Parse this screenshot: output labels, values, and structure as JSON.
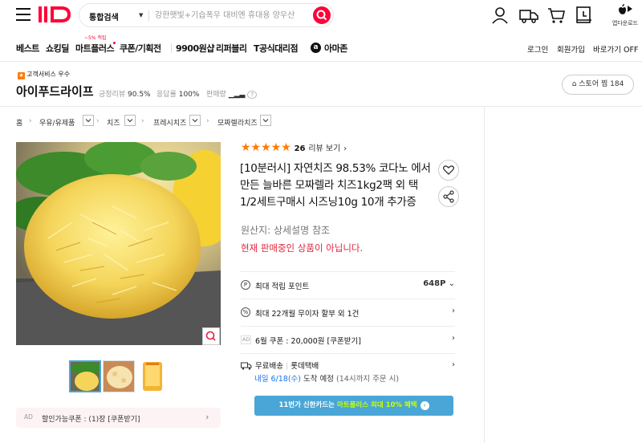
{
  "header": {
    "logo": "11",
    "search_category": "통합검색",
    "search_placeholder": "강한햇빛+기습폭우 대비엔 휴대용 양우산",
    "app_label": "앱다운로드"
  },
  "nav": {
    "items": [
      "베스트",
      "쇼킹딜",
      "마트플러스",
      "쿠폰/기획전",
      "9900원샵",
      "리퍼블리",
      "T공식대리점",
      "아마존"
    ],
    "badge": "~5% 적립",
    "right": [
      "로그인",
      "회원가입",
      "바로가기 OFF"
    ]
  },
  "store": {
    "badge": "고객서비스 우수",
    "name": "아이푸드라이프",
    "review_label": "긍정리뷰",
    "review_value": "90.5%",
    "reply_label": "응답률",
    "reply_value": "100%",
    "sales_label": "판매량",
    "store_button": "스토어 찜 184"
  },
  "breadcrumb": [
    "홈",
    "우유/유제품",
    "치즈",
    "프레시치즈",
    "모짜렐라치즈"
  ],
  "product": {
    "rating_stars": "★★★★★",
    "review_count": "26",
    "review_link": "리뷰 보기",
    "title": "[10분러시] 자연치즈 98.53% 코다노 에서만든 늘바른 모짜렐라 치즈1kg2팩 외 택1/2세트구매시 시즈닝10g 10개 추가증",
    "origin": "원산지: 상세설명 참조",
    "not_on_sale": "현재 판매중인 상품이 아닙니다.",
    "rows": {
      "points_label": "최대 적립 포인트",
      "points_value": "648P",
      "installment": "최대 22개월 무이자 할부 외 1건",
      "ad_tag": "AD",
      "coupon": "6월 쿠폰 : 20,000원 [쿠폰받기]",
      "shipping": "무료배송",
      "carrier": "롯데택배",
      "delivery_date": "내일 6/18(수)",
      "delivery_rest": "도착 예정",
      "delivery_note": "(14시까지 주문 시)"
    },
    "cta_prefix": "11번가 신한카드는",
    "cta_highlight": "마트플러스 최대 10% 혜택",
    "discount_coupon": "할인가능쿠폰 : (1)장 [쿠폰받기]",
    "discount_ad": "AD"
  },
  "colors": {
    "brand": "#ff0038",
    "star": "#ff7a00",
    "cta": "#49a6d6",
    "warn": "#e0243b"
  }
}
